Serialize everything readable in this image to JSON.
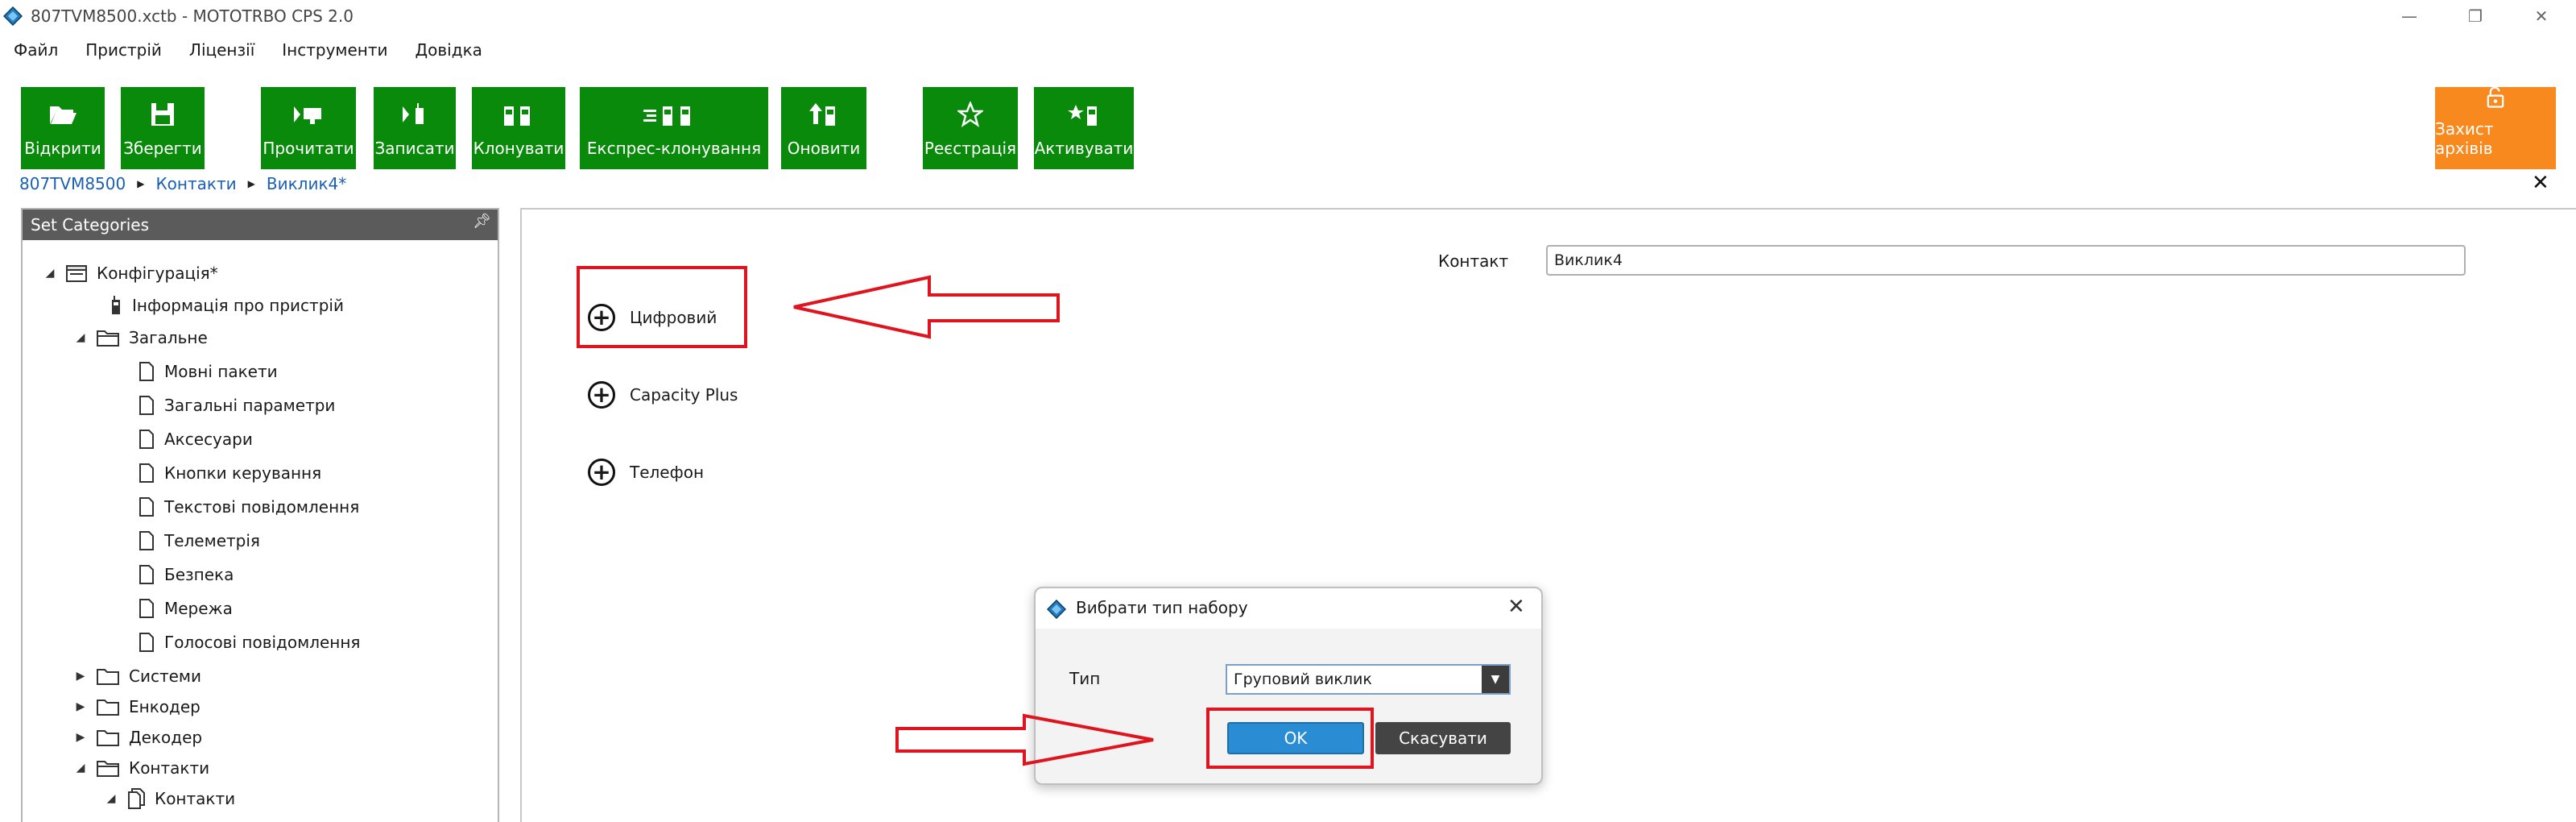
{
  "window": {
    "title": "807TVM8500.xctb - MOTOTRBO CPS 2.0",
    "minimize_glyph": "—",
    "maximize_glyph": "❐",
    "close_glyph": "✕"
  },
  "menu": [
    "Файл",
    "Пристрій",
    "Ліцензії",
    "Інструменти",
    "Довідка"
  ],
  "toolbar": {
    "open": "Відкрити",
    "save": "Зберегти",
    "read": "Прочитати",
    "write": "Записати",
    "clone": "Клонувати",
    "express_clone": "Експрес-клонування",
    "update": "Оновити",
    "register": "Реєстрація",
    "activate": "Активувати",
    "archive_protect": "Захист архівів"
  },
  "breadcrumb": [
    "807TVM8500",
    "Контакти",
    "Виклик4*"
  ],
  "left_panel": {
    "header": "Set Categories",
    "tree": {
      "config": "Конфігурація*",
      "device_info": "Інформація про пристрій",
      "general": "Загальне",
      "language_packs": "Мовні пакети",
      "general_params": "Загальні параметри",
      "accessories": "Аксесуари",
      "control_buttons": "Кнопки керування",
      "text_messages": "Текстові повідомлення",
      "telemetry": "Телеметрія",
      "security": "Безпека",
      "network": "Мережа",
      "voice_messages": "Голосові повідомлення",
      "systems": "Системи",
      "encoder": "Енкодер",
      "decoder": "Декодер",
      "contacts": "Контакти",
      "contacts_child": "Контакти"
    }
  },
  "content": {
    "contact_label": "Контакт",
    "contact_value": "Виклик4",
    "expanders": [
      "Цифровий",
      "Capacity Plus",
      "Телефон"
    ]
  },
  "dialog": {
    "title": "Вибрати тип набору",
    "type_label": "Тип",
    "type_value": "Груповий виклик",
    "ok": "OK",
    "cancel": "Скасувати"
  },
  "colors": {
    "toolbar_green": "#0a8a0a",
    "toolbar_orange": "#f7891f",
    "annotation_red": "#e0141e",
    "link_blue": "#1a5fb4"
  }
}
